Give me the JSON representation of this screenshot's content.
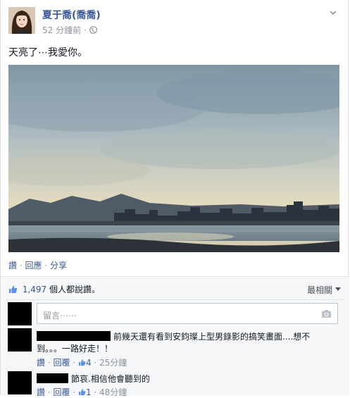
{
  "post": {
    "author": "夏于喬(喬喬)",
    "time": "52 分鐘前",
    "meta_sep": "·",
    "status_text": "天亮了⋯我愛你。",
    "actions": {
      "like": "讚",
      "comment": "回應",
      "share": "分享",
      "sep": "·"
    }
  },
  "ufi": {
    "like_count": "1,497",
    "like_text": "個人都說讚。",
    "sort_label": "最相關",
    "comment_placeholder": "留言⋯⋯",
    "comments": [
      {
        "text_line1": "前幾天還有看到安鈞璨上型男錄影的搞笑畫面....想不",
        "text_line2": "到。。。一路好走！！",
        "like": "讚",
        "reply": "回覆",
        "likes": "4",
        "time": "25分鐘"
      },
      {
        "text_line1": "節哀.相信他會聽到的",
        "like": "讚",
        "reply": "回覆",
        "likes": "1",
        "time": "48分鐘"
      }
    ]
  },
  "colors": {
    "link": "#3b5998",
    "muted": "#90949c",
    "ufi_bg": "#f6f7f9"
  },
  "icons": [
    "globe-icon",
    "chevron-down-icon",
    "thumbs-up-icon",
    "camera-icon"
  ]
}
